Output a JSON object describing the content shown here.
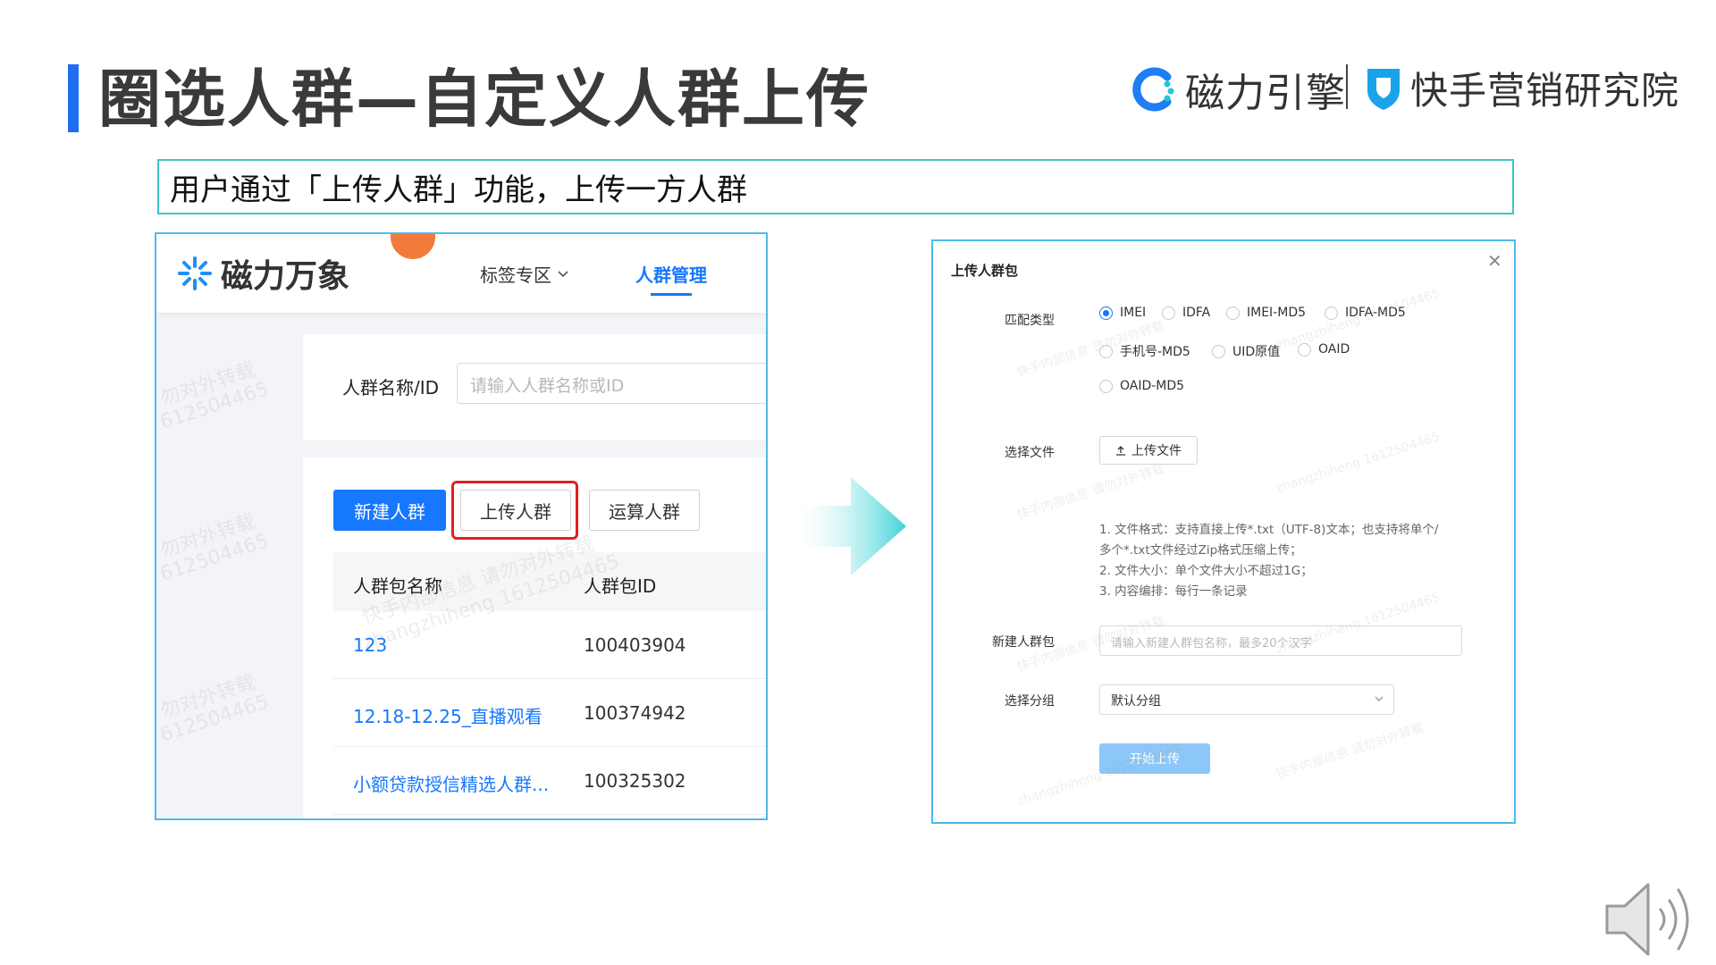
{
  "slide": {
    "title": "圈选人群—自定义人群上传",
    "subtitle": "用户通过「上传人群」功能，上传一方人群",
    "logo_left": "磁力引擎",
    "logo_right": "快手营销研究院"
  },
  "colors": {
    "accent_blue": "#1677ff",
    "title_bar": "#1f6df2",
    "highlight_red": "#e02020",
    "frame_border": "#4fb9ef",
    "subtitle_border": "#3cc6c6"
  },
  "left_app": {
    "brand": "磁力万象",
    "nav": {
      "tags_label": "标签专区",
      "crowd_label": "人群管理"
    },
    "search": {
      "label": "人群名称/ID",
      "placeholder": "请输入人群名称或ID"
    },
    "buttons": {
      "new": "新建人群",
      "upload": "上传人群",
      "compute": "运算人群"
    },
    "table": {
      "headers": [
        "人群包名称",
        "人群包ID"
      ],
      "rows": [
        {
          "name": "123",
          "id": "100403904"
        },
        {
          "name": "12.18-12.25_直播观看",
          "id": "100374942"
        },
        {
          "name": "小额贷款授信精选人群...",
          "id": "100325302"
        }
      ]
    },
    "watermarks": [
      "勿对外转载",
      "612504465",
      "快手内部信息 请勿对外转载",
      "zhangzhiheng 1612504465"
    ]
  },
  "modal": {
    "title": "上传人群包",
    "close_icon": "close-icon",
    "match_type": {
      "label": "匹配类型",
      "options": [
        "IMEI",
        "IDFA",
        "IMEI-MD5",
        "IDFA-MD5",
        "手机号-MD5",
        "UID原值",
        "OAID",
        "OAID-MD5"
      ],
      "selected": "IMEI"
    },
    "file": {
      "label": "选择文件",
      "button": "上传文件"
    },
    "tips": [
      "1. 文件格式：支持直接上传*.txt（UTF-8)文本；也支持将单个/",
      "多个*.txt文件经过Zip格式压缩上传；",
      "2. 文件大小：单个文件大小不超过1G；",
      "3. 内容编排：每行一条记录"
    ],
    "new_pack": {
      "label": "新建人群包",
      "placeholder": "请输入新建人群包名称，最多20个汉字"
    },
    "group": {
      "label": "选择分组",
      "value": "默认分组"
    },
    "submit": "开始上传"
  }
}
